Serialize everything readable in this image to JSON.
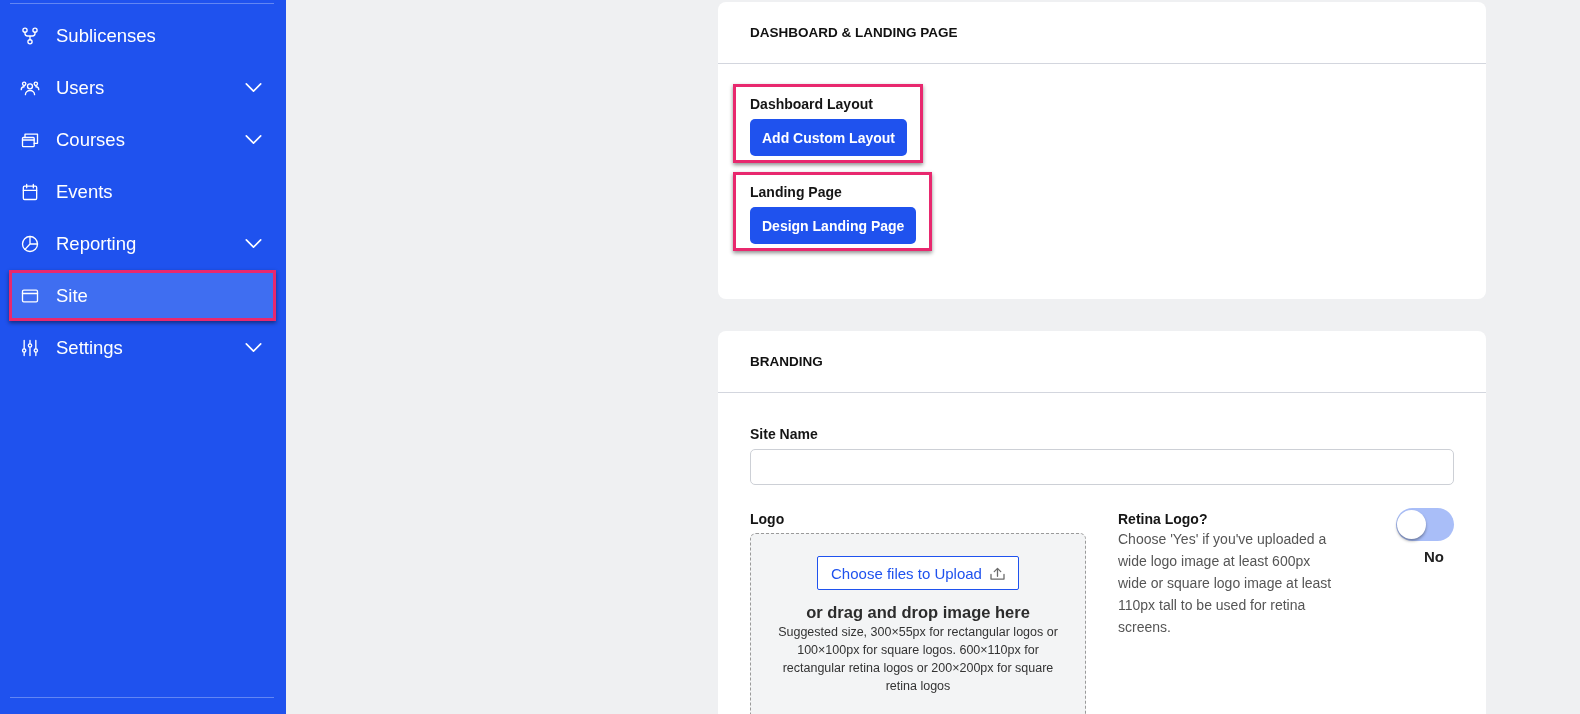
{
  "sidebar": {
    "items": [
      {
        "label": "Sublicenses",
        "expandable": false,
        "selected": false,
        "highlighted": false
      },
      {
        "label": "Users",
        "expandable": true,
        "selected": false,
        "highlighted": false
      },
      {
        "label": "Courses",
        "expandable": true,
        "selected": false,
        "highlighted": false
      },
      {
        "label": "Events",
        "expandable": false,
        "selected": false,
        "highlighted": false
      },
      {
        "label": "Reporting",
        "expandable": true,
        "selected": false,
        "highlighted": false
      },
      {
        "label": "Site",
        "expandable": false,
        "selected": true,
        "highlighted": true
      },
      {
        "label": "Settings",
        "expandable": true,
        "selected": false,
        "highlighted": false
      }
    ]
  },
  "dashboard": {
    "title": "DASHBOARD & LANDING PAGE",
    "fields": [
      {
        "label": "Dashboard Layout",
        "button": "Add Custom Layout",
        "highlighted": true
      },
      {
        "label": "Landing Page",
        "button": "Design Landing Page",
        "highlighted": true
      }
    ]
  },
  "branding": {
    "title": "BRANDING",
    "site_name": {
      "label": "Site Name"
    },
    "logo": {
      "label": "Logo",
      "upload_button": "Choose files to Upload",
      "drop_text": "or drag and drop image here",
      "hint": "Suggested size, 300×55px for rectangular logos or 100×100px for square logos. 600×110px for rectangular retina logos or 200×200px for square retina logos"
    },
    "retina_logo": {
      "label": "Retina Logo?",
      "description": "Choose 'Yes' if you've uploaded a wide logo image at least 600px wide or square logo image at least 110px tall to be used for retina screens.",
      "on": false,
      "state_text": "No"
    }
  }
}
